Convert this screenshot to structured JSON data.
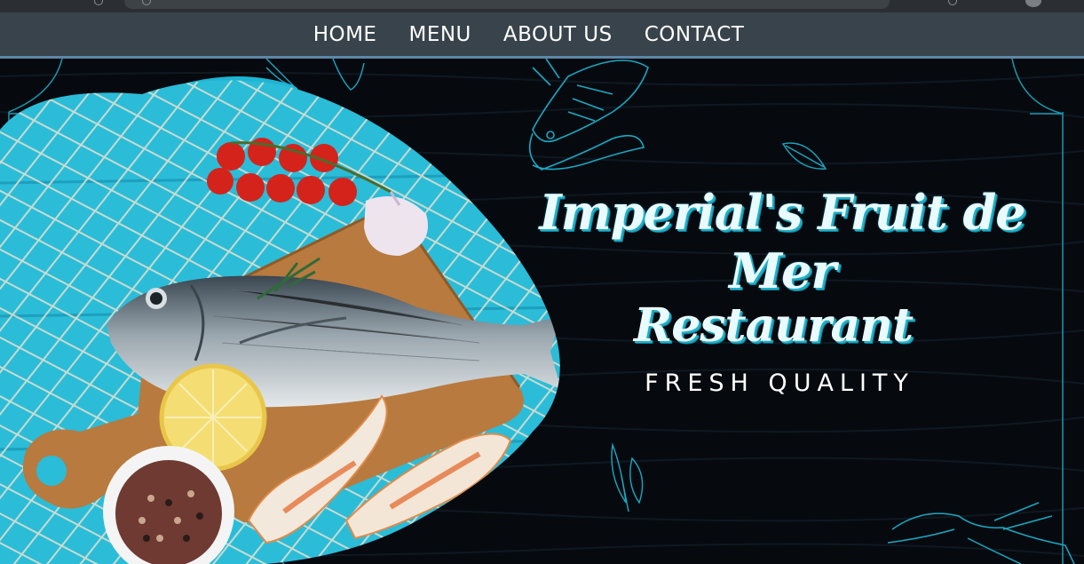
{
  "nav": {
    "items": [
      {
        "label": "HOME"
      },
      {
        "label": "MENU"
      },
      {
        "label": "ABOUT US"
      },
      {
        "label": "CONTACT"
      }
    ]
  },
  "hero": {
    "title_line1": "Imperial's Fruit de Mer",
    "title_line2": "Restaurant",
    "tagline": "FRESH QUALITY"
  },
  "colors": {
    "navbar_bg": "#38434b",
    "navbar_border": "#5c87a6",
    "accent_cyan": "#1fb1c9",
    "background": "#060a0f"
  },
  "images": {
    "hero_photo": "seafood-platter-image",
    "decorations": [
      "shrimp-sketch-icon",
      "leaf-sketch-icon",
      "lobster-sketch-icon",
      "fish-sketch-icon"
    ]
  }
}
